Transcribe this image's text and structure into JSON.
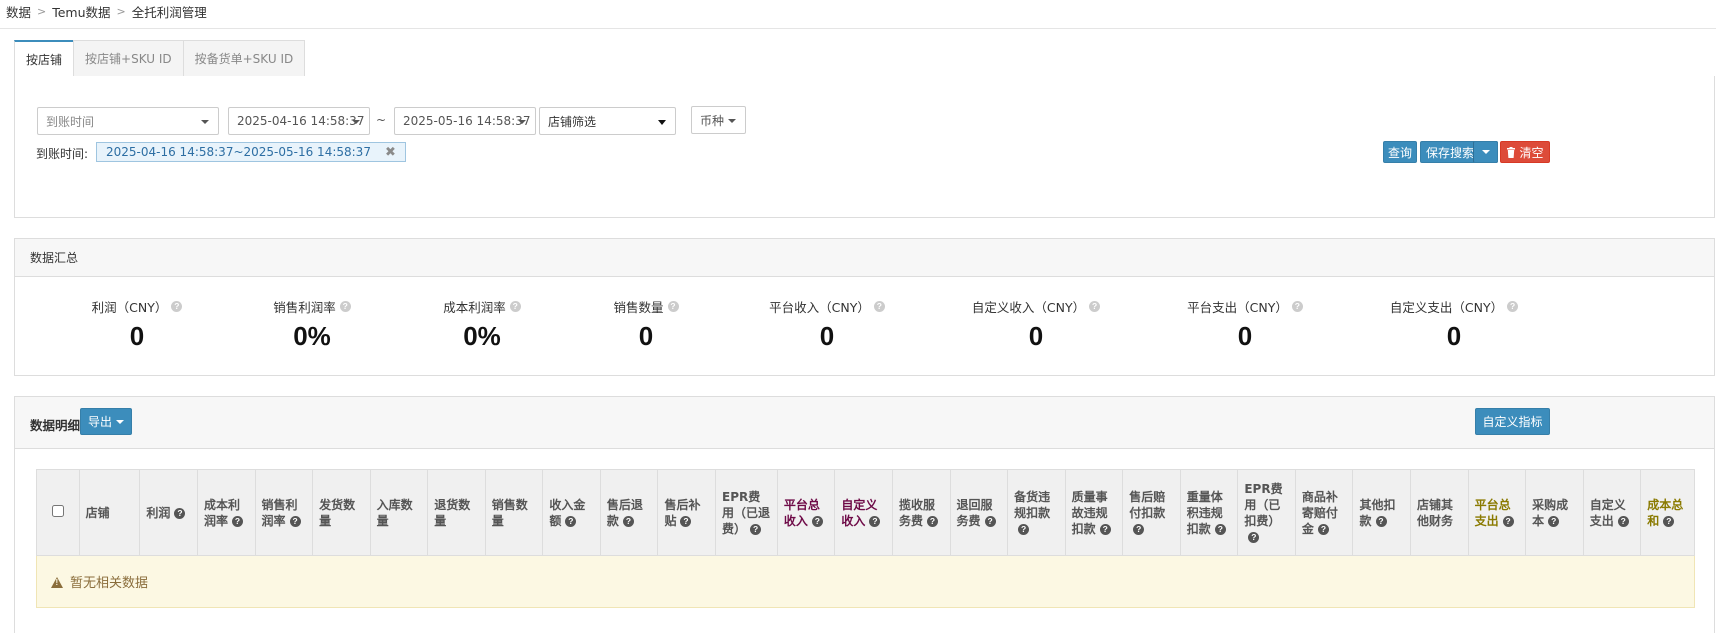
{
  "breadcrumb": [
    "数据",
    "Temu数据",
    "全托利润管理"
  ],
  "tabs": [
    {
      "label": "按店铺",
      "active": true
    },
    {
      "label": "按店铺+SKU ID",
      "active": false
    },
    {
      "label": "按备货单+SKU ID",
      "active": false
    }
  ],
  "filters": {
    "time_type": "到账时间",
    "start": "2025-04-16 14:58:37",
    "tilde": "~",
    "end": "2025-05-16 14:58:37",
    "store": "店铺筛选",
    "currency": "币种",
    "applied_label": "到账时间:",
    "applied_value": "2025-04-16 14:58:37~2025-05-16 14:58:37",
    "chip_close": "✖"
  },
  "actions": {
    "query": "查询",
    "save_search": "保存搜索",
    "clear": "清空",
    "clear_icon": "trash-icon"
  },
  "summary": {
    "title": "数据汇总",
    "stats": [
      {
        "label": "利润（CNY）",
        "value": "0"
      },
      {
        "label": "销售利润率",
        "value": "0%"
      },
      {
        "label": "成本利润率",
        "value": "0%"
      },
      {
        "label": "销售数量",
        "value": "0"
      },
      {
        "label": "平台收入（CNY）",
        "value": "0"
      },
      {
        "label": "自定义收入（CNY）",
        "value": "0"
      },
      {
        "label": "平台支出（CNY）",
        "value": "0"
      },
      {
        "label": "自定义支出（CNY）",
        "value": "0"
      }
    ]
  },
  "detail": {
    "title": "数据明细",
    "export": "导出",
    "custom_metrics": "自定义指标",
    "empty_message": "暂无相关数据",
    "columns": [
      {
        "label": "店铺",
        "help": false,
        "color": "default"
      },
      {
        "label": "利润",
        "help": true,
        "color": "default"
      },
      {
        "label": "成本利润率",
        "help": true,
        "color": "default"
      },
      {
        "label": "销售利润率",
        "help": true,
        "color": "default"
      },
      {
        "label": "发货数量",
        "help": false,
        "color": "default"
      },
      {
        "label": "入库数量",
        "help": false,
        "color": "default"
      },
      {
        "label": "退货数量",
        "help": false,
        "color": "default"
      },
      {
        "label": "销售数量",
        "help": false,
        "color": "default"
      },
      {
        "label": "收入金额",
        "help": true,
        "color": "default"
      },
      {
        "label": "售后退款",
        "help": true,
        "color": "default"
      },
      {
        "label": "售后补贴",
        "help": true,
        "color": "default"
      },
      {
        "label": "EPR费用（已退费）",
        "help": true,
        "color": "default"
      },
      {
        "label": "平台总收入",
        "help": true,
        "color": "purple"
      },
      {
        "label": "自定义收入",
        "help": true,
        "color": "purple"
      },
      {
        "label": "揽收服务费",
        "help": true,
        "color": "default"
      },
      {
        "label": "退回服务费",
        "help": true,
        "color": "default"
      },
      {
        "label": "备货违规扣款",
        "help": true,
        "color": "default"
      },
      {
        "label": "质量事故违规扣款",
        "help": true,
        "color": "default"
      },
      {
        "label": "售后赔付扣款",
        "help": true,
        "color": "default"
      },
      {
        "label": "重量体积违规扣款",
        "help": true,
        "color": "default"
      },
      {
        "label": "EPR费用（已扣费）",
        "help": true,
        "color": "default"
      },
      {
        "label": "商品补寄赔付金",
        "help": true,
        "color": "default"
      },
      {
        "label": "其他扣款",
        "help": true,
        "color": "default"
      },
      {
        "label": "店铺其他财务",
        "help": false,
        "color": "default"
      },
      {
        "label": "平台总支出",
        "help": true,
        "color": "olive"
      },
      {
        "label": "采购成本",
        "help": true,
        "color": "default"
      },
      {
        "label": "自定义支出",
        "help": true,
        "color": "default"
      },
      {
        "label": "成本总和",
        "help": true,
        "color": "olive"
      }
    ]
  },
  "colors": {
    "primary": "#3c8dbc",
    "danger": "#dd4b39",
    "purple_header": "#6e0a47",
    "olive_header": "#8a7a00",
    "warning_bg": "#fcf8e3"
  }
}
